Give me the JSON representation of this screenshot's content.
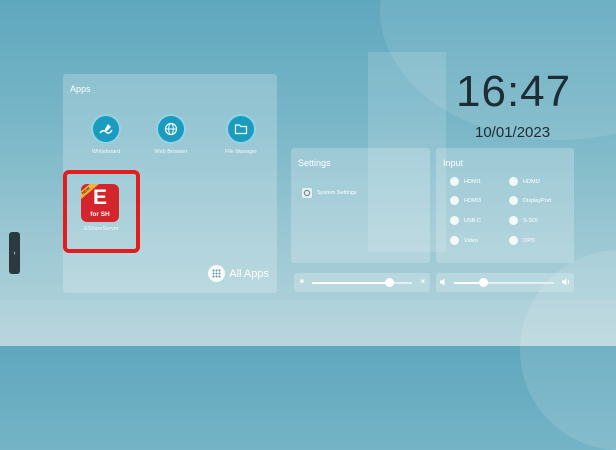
{
  "apps_panel": {
    "title": "Apps",
    "items": [
      {
        "label": "Whiteboard",
        "icon": "whiteboard-pen-icon"
      },
      {
        "label": "Web Browser",
        "icon": "globe-icon"
      },
      {
        "label": "File Manager",
        "icon": "folder-icon"
      }
    ],
    "highlighted_app": {
      "label": "EShareServer",
      "icon_text": "E",
      "icon_subtext": "for SH",
      "ribbon": "NEW"
    },
    "all_apps_label": "All Apps"
  },
  "clock": {
    "time": "16:47",
    "date": "10/01/2023"
  },
  "settings_panel": {
    "title": "Settings",
    "system_settings_label": "System Settings"
  },
  "input_panel": {
    "title": "Input",
    "sources": [
      "HDMI1",
      "HDMI2",
      "HDMI3",
      "DisplayPort",
      "USB-C",
      "S-SDI",
      "Video",
      "OPS"
    ]
  },
  "brightness": {
    "level": 0.77
  },
  "volume": {
    "level": 0.29
  },
  "colors": {
    "highlight": "#e21d1d",
    "app_icon": "#1a9bc0",
    "eshare_icon": "#d3252b"
  }
}
